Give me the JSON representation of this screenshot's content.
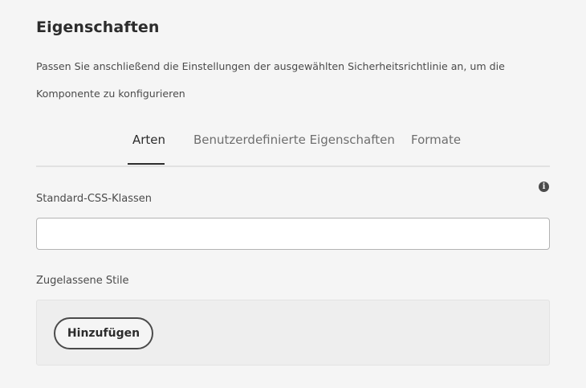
{
  "header": {
    "title": "Eigenschaften",
    "description": "Passen Sie anschließend die Einstellungen der ausgewählten Sicherheitsrichtlinie an, um die Komponente zu konfigurieren"
  },
  "tabs": [
    {
      "label": "Arten",
      "active": true
    },
    {
      "label": "Benutzerdefinierte Eigenschaften",
      "active": false
    },
    {
      "label": "Formate",
      "active": false
    }
  ],
  "css_classes": {
    "label": "Standard-CSS-Klassen",
    "value": "",
    "placeholder": "",
    "info_icon": "info-icon"
  },
  "allowed_styles": {
    "label": "Zugelassene Stile",
    "add_button_label": "Hinzufügen"
  },
  "colors": {
    "background": "#f5f5f5",
    "text": "#2c2c2c",
    "muted_text": "#6e6e6e",
    "input_border": "#b3b3b3",
    "active_tab_indicator": "#2c2c2c"
  }
}
